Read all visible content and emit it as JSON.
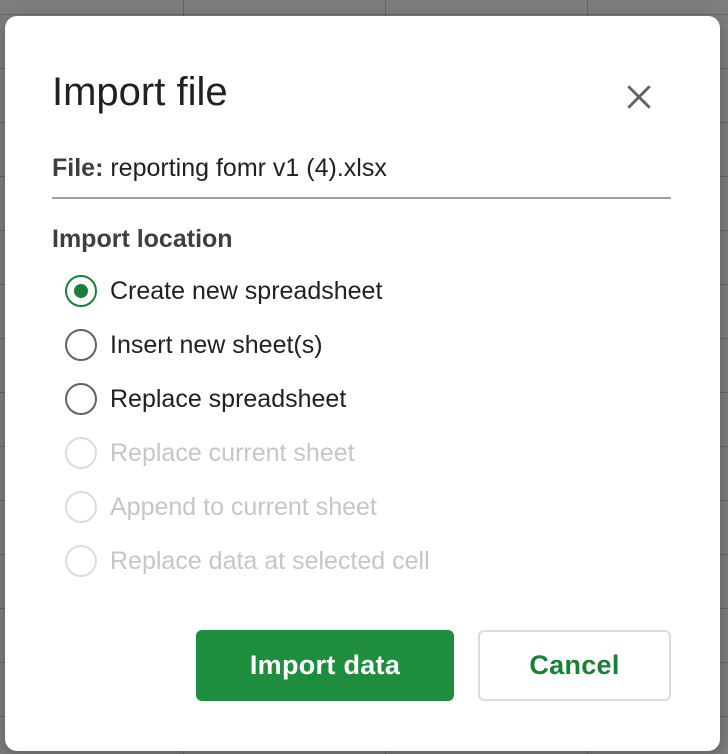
{
  "dialog": {
    "title": "Import file",
    "close_icon": "close-icon",
    "file_label": "File:",
    "file_name": " reporting fomr v1 (4).xlsx",
    "section_label": "Import location",
    "options": [
      {
        "label": "Create new spreadsheet",
        "checked": true,
        "disabled": false
      },
      {
        "label": "Insert new sheet(s)",
        "checked": false,
        "disabled": false
      },
      {
        "label": "Replace spreadsheet",
        "checked": false,
        "disabled": false
      },
      {
        "label": "Replace current sheet",
        "checked": false,
        "disabled": true
      },
      {
        "label": "Append to current sheet",
        "checked": false,
        "disabled": true
      },
      {
        "label": "Replace data at selected cell",
        "checked": false,
        "disabled": true
      }
    ],
    "primary_button": "Import data",
    "secondary_button": "Cancel"
  },
  "colors": {
    "accent": "#188038",
    "primary_button_bg": "#1e8e3e",
    "disabled_text": "#c4c6c9",
    "overlay": "#7f7f7f"
  }
}
